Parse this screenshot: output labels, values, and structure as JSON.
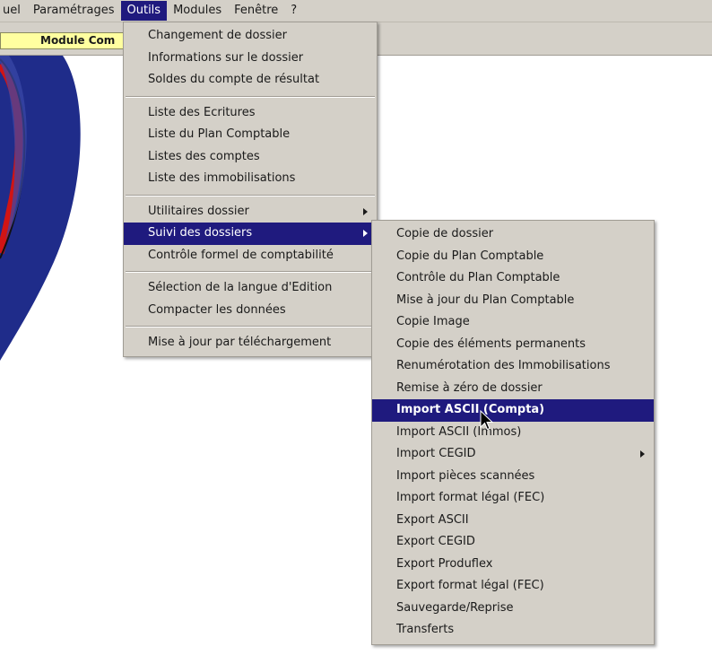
{
  "menubar": {
    "items": [
      {
        "label": "uel"
      },
      {
        "label": "Paramétrages"
      },
      {
        "label": "Outils"
      },
      {
        "label": "Modules"
      },
      {
        "label": "Fenêtre"
      },
      {
        "label": "?"
      }
    ]
  },
  "module_tab": {
    "label": "Module Com"
  },
  "outils_menu": {
    "group1": [
      {
        "label": "Changement de dossier"
      },
      {
        "label": "Informations sur le dossier"
      },
      {
        "label": "Soldes du compte de résultat"
      }
    ],
    "group2": [
      {
        "label": "Liste des Ecritures"
      },
      {
        "label": "Liste du Plan Comptable"
      },
      {
        "label": "Listes des comptes"
      },
      {
        "label": "Liste des immobilisations"
      }
    ],
    "group3": [
      {
        "label": "Utilitaires dossier"
      },
      {
        "label": "Suivi des dossiers"
      },
      {
        "label": "Contrôle formel de comptabilité"
      }
    ],
    "group4": [
      {
        "label": "Sélection de la langue d'Edition"
      },
      {
        "label": "Compacter les données"
      }
    ],
    "group5": [
      {
        "label": "Mise à jour par téléchargement"
      }
    ]
  },
  "suivi_submenu": {
    "items": [
      {
        "label": "Copie de dossier"
      },
      {
        "label": "Copie du Plan Comptable"
      },
      {
        "label": "Contrôle du Plan Comptable"
      },
      {
        "label": "Mise à jour du Plan Comptable"
      },
      {
        "label": "Copie Image"
      },
      {
        "label": "Copie des éléments permanents"
      },
      {
        "label": "Renumérotation des Immobilisations"
      },
      {
        "label": "Remise à zéro de dossier"
      },
      {
        "label": "Import ASCII (Compta)"
      },
      {
        "label": "Import ASCII (Immos)"
      },
      {
        "label": "Import CEGID"
      },
      {
        "label": "Import pièces scannées"
      },
      {
        "label": "Import format légal (FEC)"
      },
      {
        "label": "Export ASCII"
      },
      {
        "label": "Export CEGID"
      },
      {
        "label": "Export Produflex"
      },
      {
        "label": "Export format légal (FEC)"
      },
      {
        "label": "Sauvegarde/Reprise"
      },
      {
        "label": "Transferts"
      }
    ]
  },
  "colors": {
    "menu_bg": "#d4d0c8",
    "highlight": "#1f1a7e",
    "module_tab": "#ffffa0",
    "logo_blue": "#1f2c8a",
    "logo_red": "#d11414"
  }
}
